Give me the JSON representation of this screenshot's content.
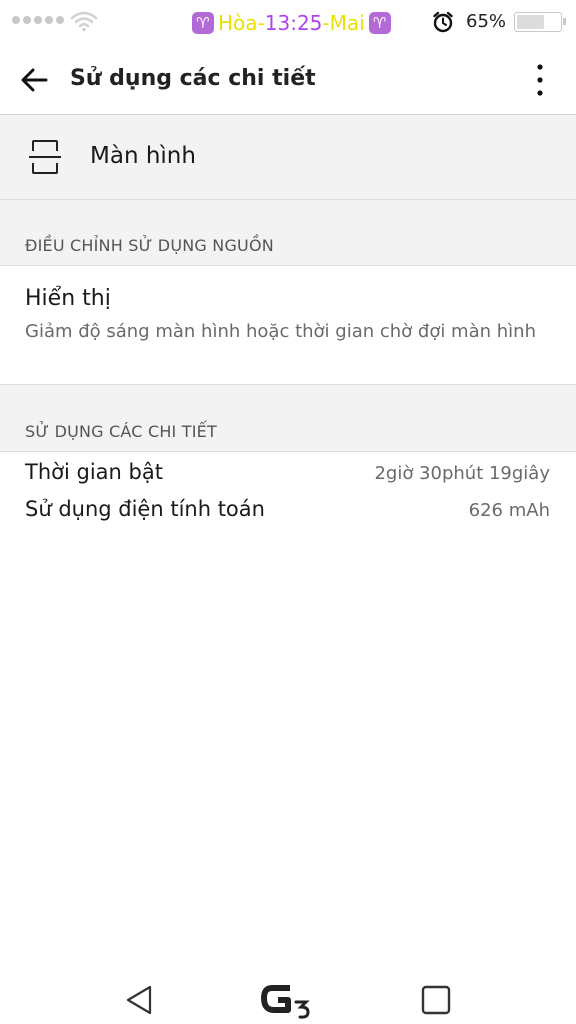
{
  "status_bar": {
    "zodiac_left": "♈",
    "zodiac_right": "♈",
    "prefix": "Hòa-",
    "time": "13:25",
    "suffix": "-Mai",
    "battery_percent_text": "65%",
    "battery_level": 0.65,
    "signal_bars_filled": 0,
    "colors": {
      "zodiac_bg": "#b46ad6",
      "status_text": "#e9e100",
      "time_text": "#b043f0"
    },
    "icons": [
      "signal-dots-icon",
      "wifi-icon",
      "alarm-clock-icon",
      "battery-icon"
    ]
  },
  "app_bar": {
    "title": "Sử dụng các chi tiết",
    "back_icon": "arrow-left-icon",
    "menu_icon": "more-vertical-icon"
  },
  "app_item": {
    "label": "Màn hình",
    "icon": "screen-icon"
  },
  "sections": {
    "power_adjust": {
      "header": "ĐIỀU CHỈNH SỬ DỤNG NGUỒN",
      "item": {
        "title": "Hiển thị",
        "description": "Giảm độ sáng màn hình hoặc thời gian chờ đợi màn hình"
      }
    },
    "usage_details": {
      "header": "SỬ DỤNG CÁC CHI TIẾT",
      "rows": [
        {
          "label": "Thời gian bật",
          "value": "2giờ 30phút 19giây"
        },
        {
          "label": "Sử dụng điện tính toán",
          "value": "626 mAh"
        }
      ]
    }
  },
  "nav_bar": {
    "back_icon": "nav-back-triangle-icon",
    "home_icon": "g3-home-logo-icon",
    "recent_icon": "nav-recent-square-icon"
  }
}
